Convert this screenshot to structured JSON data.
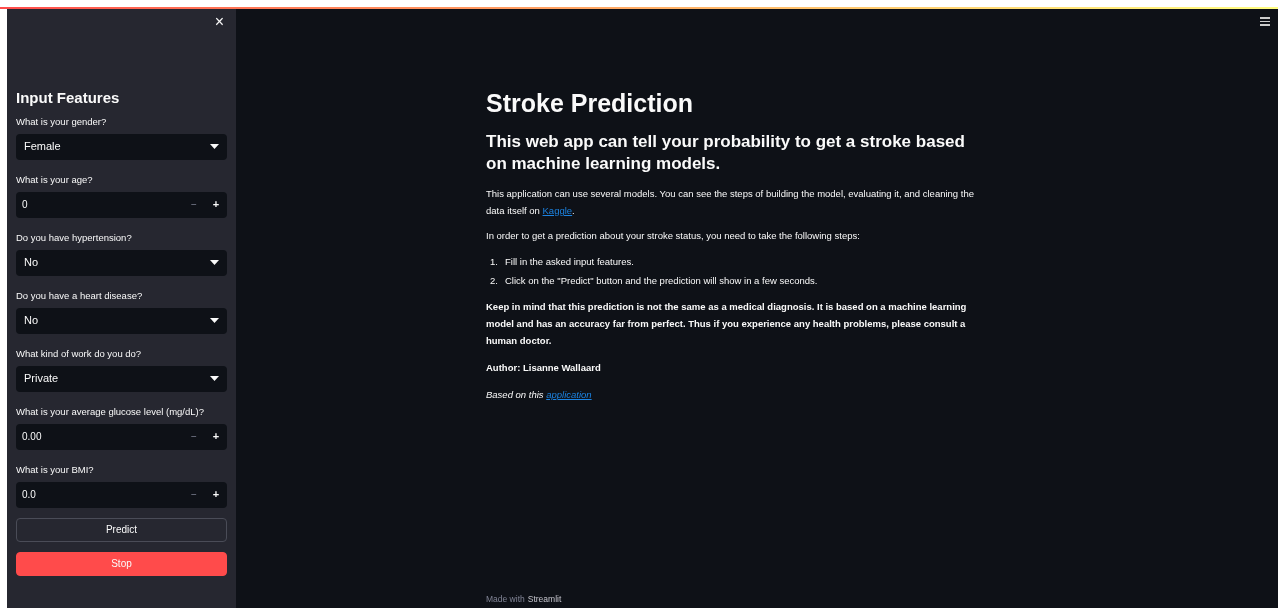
{
  "sidebar": {
    "close_icon": "×",
    "title": "Input Features",
    "fields": [
      {
        "kind": "select",
        "label": "What is your gender?",
        "value": "Female"
      },
      {
        "kind": "number",
        "label": "What is your age?",
        "value": "0",
        "minus": "−",
        "plus": "+"
      },
      {
        "kind": "select",
        "label": "Do you have hypertension?",
        "value": "No"
      },
      {
        "kind": "select",
        "label": "Do you have a heart disease?",
        "value": "No"
      },
      {
        "kind": "select",
        "label": "What kind of work do you do?",
        "value": "Private"
      },
      {
        "kind": "number",
        "label": "What is your average glucose level (mg/dL)?",
        "value": "0.00",
        "minus": "−",
        "plus": "+"
      },
      {
        "kind": "number",
        "label": "What is your BMI?",
        "value": "0.0",
        "minus": "−",
        "plus": "+"
      }
    ],
    "buttons": [
      {
        "kind": "secondary",
        "label": "Predict"
      },
      {
        "kind": "primary",
        "label": "Stop"
      }
    ]
  },
  "main": {
    "title": "Stroke Prediction",
    "subtitle": "This web app can tell your probability to get a stroke based on machine learning models.",
    "intro": {
      "before": "This application can use several models. You can see the steps of building the model, evaluating it, and cleaning the data itself on ",
      "link": "Kaggle",
      "after": "."
    },
    "steps_intro": "In order to get a prediction about your stroke status, you need to take the following steps:",
    "steps": [
      {
        "number": "1.",
        "text": "Fill in the asked input features."
      },
      {
        "number": "2.",
        "text": "Click on the \"Predict\" button and the prediction will show in a few seconds."
      }
    ],
    "disclaimer": "Keep in mind that this prediction is not the same as a medical diagnosis. It is based on a machine learning model and has an accuracy far from perfect. Thus if you experience any health problems, please consult a human doctor.",
    "author": "Author: Lisanne Wallaard",
    "based_on": {
      "before": "Based on this ",
      "link": "application"
    },
    "footer": {
      "prefix": "Made with",
      "brand": "Streamlit"
    }
  }
}
